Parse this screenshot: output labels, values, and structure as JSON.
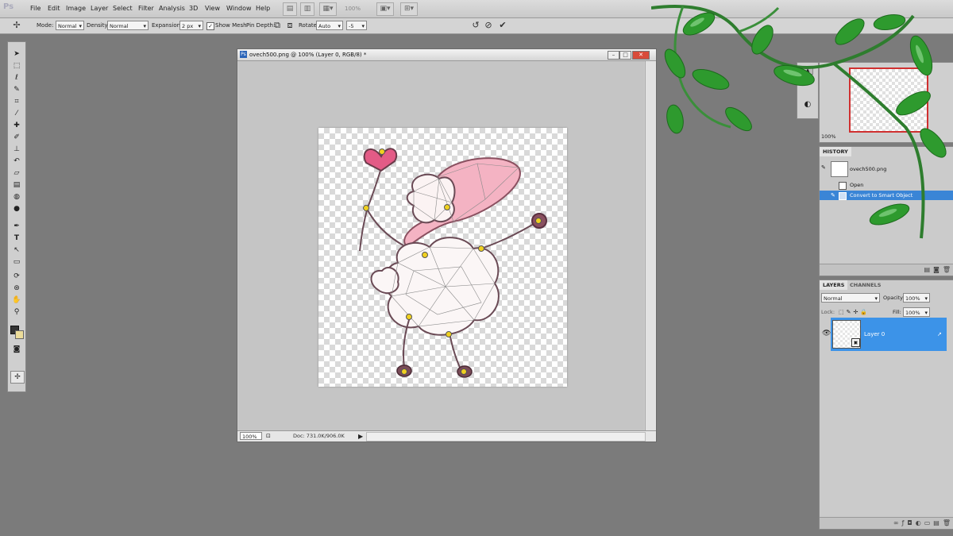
{
  "app": {
    "logo": "Ps"
  },
  "menu": [
    "File",
    "Edit",
    "Image",
    "Layer",
    "Select",
    "Filter",
    "Analysis",
    "3D",
    "View",
    "Window",
    "Help"
  ],
  "appbar": {
    "zoom": "100%"
  },
  "options": {
    "mode_label": "Mode:",
    "mode_value": "Normal",
    "density_label": "Density:",
    "density_value": "Normal",
    "expansion_label": "Expansion:",
    "expansion_value": "2 px",
    "show_mesh_label": "Show Mesh",
    "show_mesh_checked": "✓",
    "pin_depth_label": "Pin Depth:",
    "rotate_label": "Rotate:",
    "rotate_value": "Auto",
    "rotate_angle": "-5"
  },
  "document": {
    "title": "ovech500.png @ 100% (Layer 0, RGB/8) *",
    "zoom": "100%",
    "doc_size": "Doc: 731.0K/906.0K"
  },
  "navigator": {
    "zoom": "100%"
  },
  "history": {
    "tab": "HISTORY",
    "snapshot": "ovech500.png",
    "items": [
      "Open",
      "Convert to Smart Object"
    ]
  },
  "layers": {
    "tabs": [
      "LAYERS",
      "CHANNELS"
    ],
    "blend_mode": "Normal",
    "opacity_label": "Opacity:",
    "opacity_value": "100%",
    "lock_label": "Lock:",
    "fill_label": "Fill:",
    "fill_value": "100%",
    "layer_name": "Layer 0"
  },
  "colors": {
    "selection": "#3c93e8",
    "history_highlight": "#3a85d6",
    "leaf_green": "#2e9a2e",
    "pin_yellow": "#f0d020"
  }
}
